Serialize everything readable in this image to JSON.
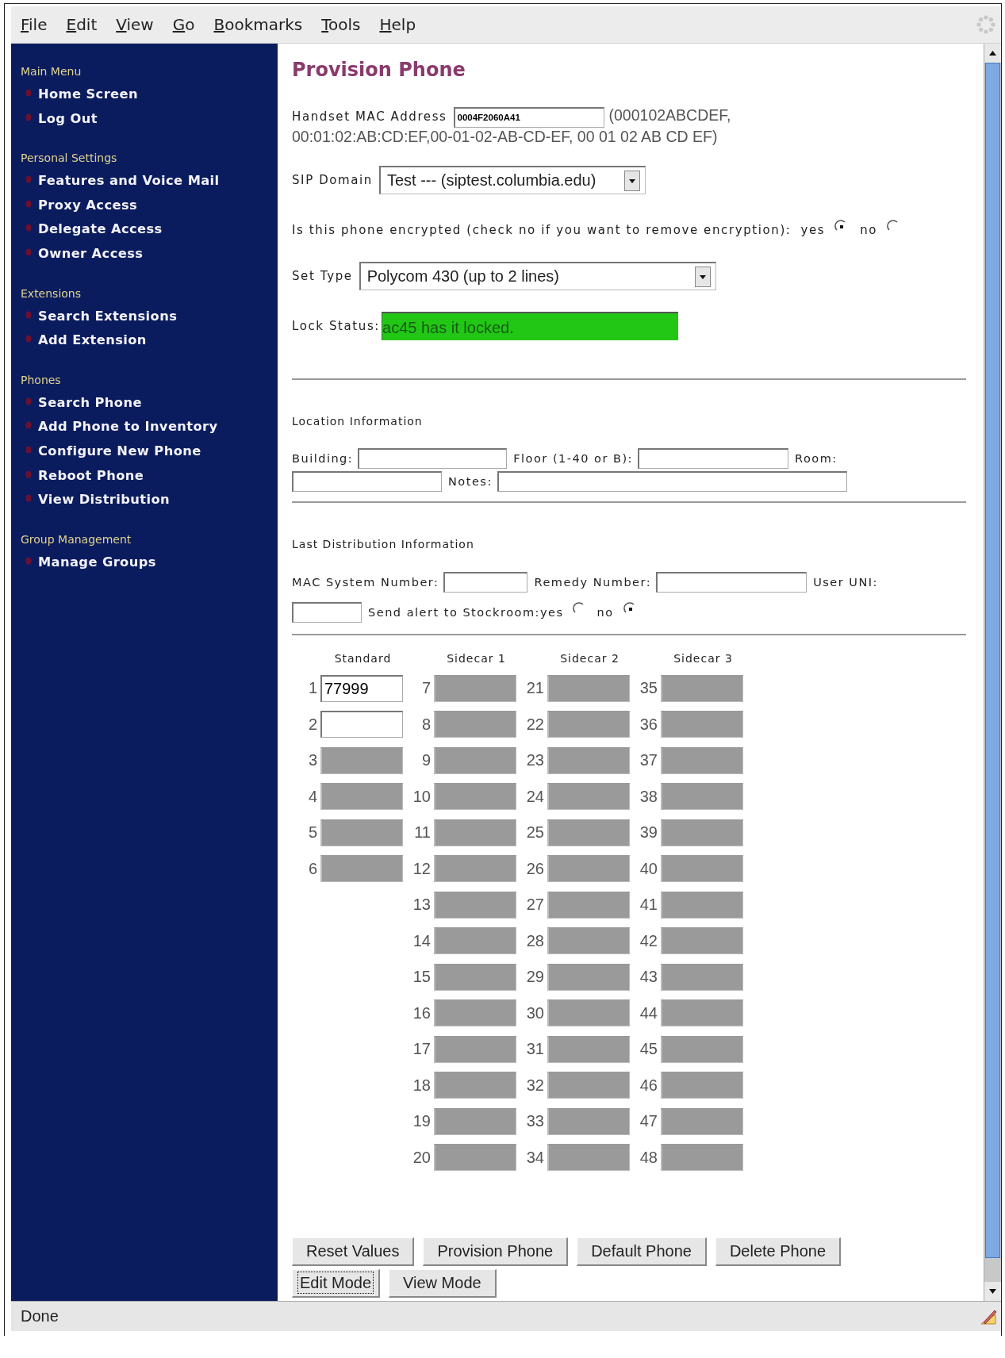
{
  "menu": [
    "File",
    "Edit",
    "View",
    "Go",
    "Bookmarks",
    "Tools",
    "Help"
  ],
  "sidebar": {
    "sections": [
      {
        "heading": "Main Menu",
        "items": [
          "Home Screen",
          "Log Out"
        ]
      },
      {
        "heading": "Personal Settings",
        "items": [
          "Features and Voice Mail",
          "Proxy Access",
          "Delegate Access",
          "Owner Access"
        ]
      },
      {
        "heading": "Extensions",
        "items": [
          "Search Extensions",
          "Add Extension"
        ]
      },
      {
        "heading": "Phones",
        "items": [
          "Search Phone",
          "Add Phone to Inventory",
          "Configure New Phone",
          "Reboot Phone",
          "View Distribution"
        ]
      },
      {
        "heading": "Group Management",
        "items": [
          "Manage Groups"
        ]
      }
    ]
  },
  "page_title": "Provision Phone",
  "mac_address": {
    "label": "Handset MAC Address",
    "value": "0004F2060A41",
    "hint_lines": [
      "(000102ABCDEF,",
      "00:01:02:AB:CD:EF,00-01-02-AB-CD-EF, 00 01 02 AB CD EF)"
    ]
  },
  "sip_domain": {
    "label": "SIP Domain",
    "value": "Test --- (siptest.columbia.edu)"
  },
  "encrypted": {
    "label": "Is this phone encrypted (check no if you want to remove encryption):",
    "options": [
      {
        "label": "yes",
        "selected": true
      },
      {
        "label": "no",
        "selected": false
      }
    ]
  },
  "set_type": {
    "label": "Set Type",
    "value": "Polycom 430 (up to 2 lines)"
  },
  "lock_status": {
    "label": "Lock Status:",
    "value": "ac45 has it locked."
  },
  "location": {
    "heading": "Location Information",
    "fields": [
      {
        "label": "Building:"
      },
      {
        "label": "Floor (1-40 or B):"
      },
      {
        "label": "Room:"
      },
      {
        "label": "Notes:"
      }
    ]
  },
  "distribution": {
    "heading": "Last Distribution Information",
    "fields": [
      {
        "label": "MAC System Number:"
      },
      {
        "label": "Remedy Number:"
      },
      {
        "label": "User UNI:"
      }
    ],
    "alert": {
      "label": "Send alert to Stockroom:",
      "options": [
        {
          "label": "yes",
          "selected": false
        },
        {
          "label": "no",
          "selected": true
        }
      ]
    }
  },
  "lines": {
    "columns": [
      {
        "heading": "Standard",
        "keys": [
          {
            "number": "1",
            "value": "77999",
            "disabled": false
          },
          {
            "number": "2",
            "disabled": false
          },
          {
            "number": "3",
            "disabled": true
          },
          {
            "number": "4",
            "disabled": true
          },
          {
            "number": "5",
            "disabled": true
          },
          {
            "number": "6",
            "disabled": true
          }
        ]
      },
      {
        "heading": "Sidecar 1",
        "keys": [
          {
            "number": "7",
            "disabled": true
          },
          {
            "number": "8",
            "disabled": true
          },
          {
            "number": "9",
            "disabled": true
          },
          {
            "number": "10",
            "disabled": true
          },
          {
            "number": "11",
            "disabled": true
          },
          {
            "number": "12",
            "disabled": true
          },
          {
            "number": "13",
            "disabled": true
          },
          {
            "number": "14",
            "disabled": true
          },
          {
            "number": "15",
            "disabled": true
          },
          {
            "number": "16",
            "disabled": true
          },
          {
            "number": "17",
            "disabled": true
          },
          {
            "number": "18",
            "disabled": true
          },
          {
            "number": "19",
            "disabled": true
          },
          {
            "number": "20",
            "disabled": true
          }
        ]
      },
      {
        "heading": "Sidecar 2",
        "keys": [
          {
            "number": "21",
            "disabled": true
          },
          {
            "number": "22",
            "disabled": true
          },
          {
            "number": "23",
            "disabled": true
          },
          {
            "number": "24",
            "disabled": true
          },
          {
            "number": "25",
            "disabled": true
          },
          {
            "number": "26",
            "disabled": true
          },
          {
            "number": "27",
            "disabled": true
          },
          {
            "number": "28",
            "disabled": true
          },
          {
            "number": "29",
            "disabled": true
          },
          {
            "number": "30",
            "disabled": true
          },
          {
            "number": "31",
            "disabled": true
          },
          {
            "number": "32",
            "disabled": true
          },
          {
            "number": "33",
            "disabled": true
          },
          {
            "number": "34",
            "disabled": true
          }
        ]
      },
      {
        "heading": "Sidecar 3",
        "keys": [
          {
            "number": "35",
            "disabled": true
          },
          {
            "number": "36",
            "disabled": true
          },
          {
            "number": "37",
            "disabled": true
          },
          {
            "number": "38",
            "disabled": true
          },
          {
            "number": "39",
            "disabled": true
          },
          {
            "number": "40",
            "disabled": true
          },
          {
            "number": "41",
            "disabled": true
          },
          {
            "number": "42",
            "disabled": true
          },
          {
            "number": "43",
            "disabled": true
          },
          {
            "number": "44",
            "disabled": true
          },
          {
            "number": "45",
            "disabled": true
          },
          {
            "number": "46",
            "disabled": true
          },
          {
            "number": "47",
            "disabled": true
          },
          {
            "number": "48",
            "disabled": true
          }
        ]
      }
    ]
  },
  "buttons": [
    {
      "label": "Reset Values",
      "focused": false
    },
    {
      "label": "Provision Phone",
      "focused": false
    },
    {
      "label": "Default Phone",
      "focused": false
    },
    {
      "label": "Delete Phone",
      "focused": false
    },
    {
      "label": "Edit Mode",
      "focused": true
    },
    {
      "label": "View Mode",
      "focused": false
    }
  ],
  "status_bar": "Done"
}
